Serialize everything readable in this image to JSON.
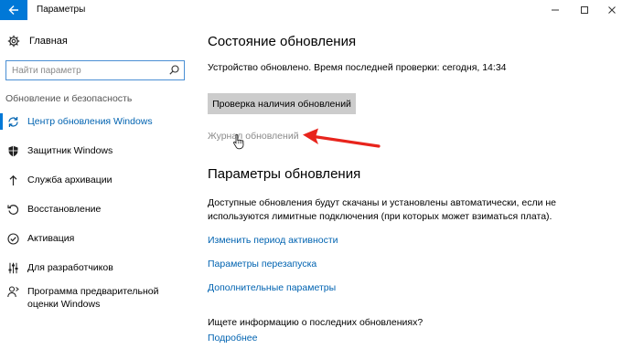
{
  "window": {
    "title": "Параметры",
    "accent": "#0078d7"
  },
  "sidebar": {
    "home_label": "Главная",
    "search_placeholder": "Найти параметр",
    "section_label": "Обновление и безопасность",
    "items": [
      {
        "label": "Центр обновления Windows",
        "icon": "sync-icon",
        "active": true
      },
      {
        "label": "Защитник Windows",
        "icon": "shield-icon",
        "active": false
      },
      {
        "label": "Служба архивации",
        "icon": "backup-arrow-icon",
        "active": false
      },
      {
        "label": "Восстановление",
        "icon": "recovery-icon",
        "active": false
      },
      {
        "label": "Активация",
        "icon": "check-circle-icon",
        "active": false
      },
      {
        "label": "Для разработчиков",
        "icon": "developer-sliders-icon",
        "active": false
      },
      {
        "label": "Программа предварительной оценки Windows",
        "icon": "insider-person-icon",
        "active": false
      }
    ]
  },
  "main": {
    "status_heading": "Состояние обновления",
    "status_text": "Устройство обновлено. Время последней проверки: сегодня, 14:34",
    "check_button": "Проверка наличия обновлений",
    "history_link": "Журнал обновлений",
    "settings_heading": "Параметры обновления",
    "settings_desc": "Доступные обновления будут скачаны и установлены автоматически, если не используются лимитные подключения (при которых может взиматься плата).",
    "links": [
      "Изменить период активности",
      "Параметры перезапуска",
      "Дополнительные параметры"
    ],
    "question": "Ищете информацию о последних обновлениях?",
    "more_link": "Подробнее"
  },
  "annotation": {
    "arrow_color": "#e8241c"
  }
}
